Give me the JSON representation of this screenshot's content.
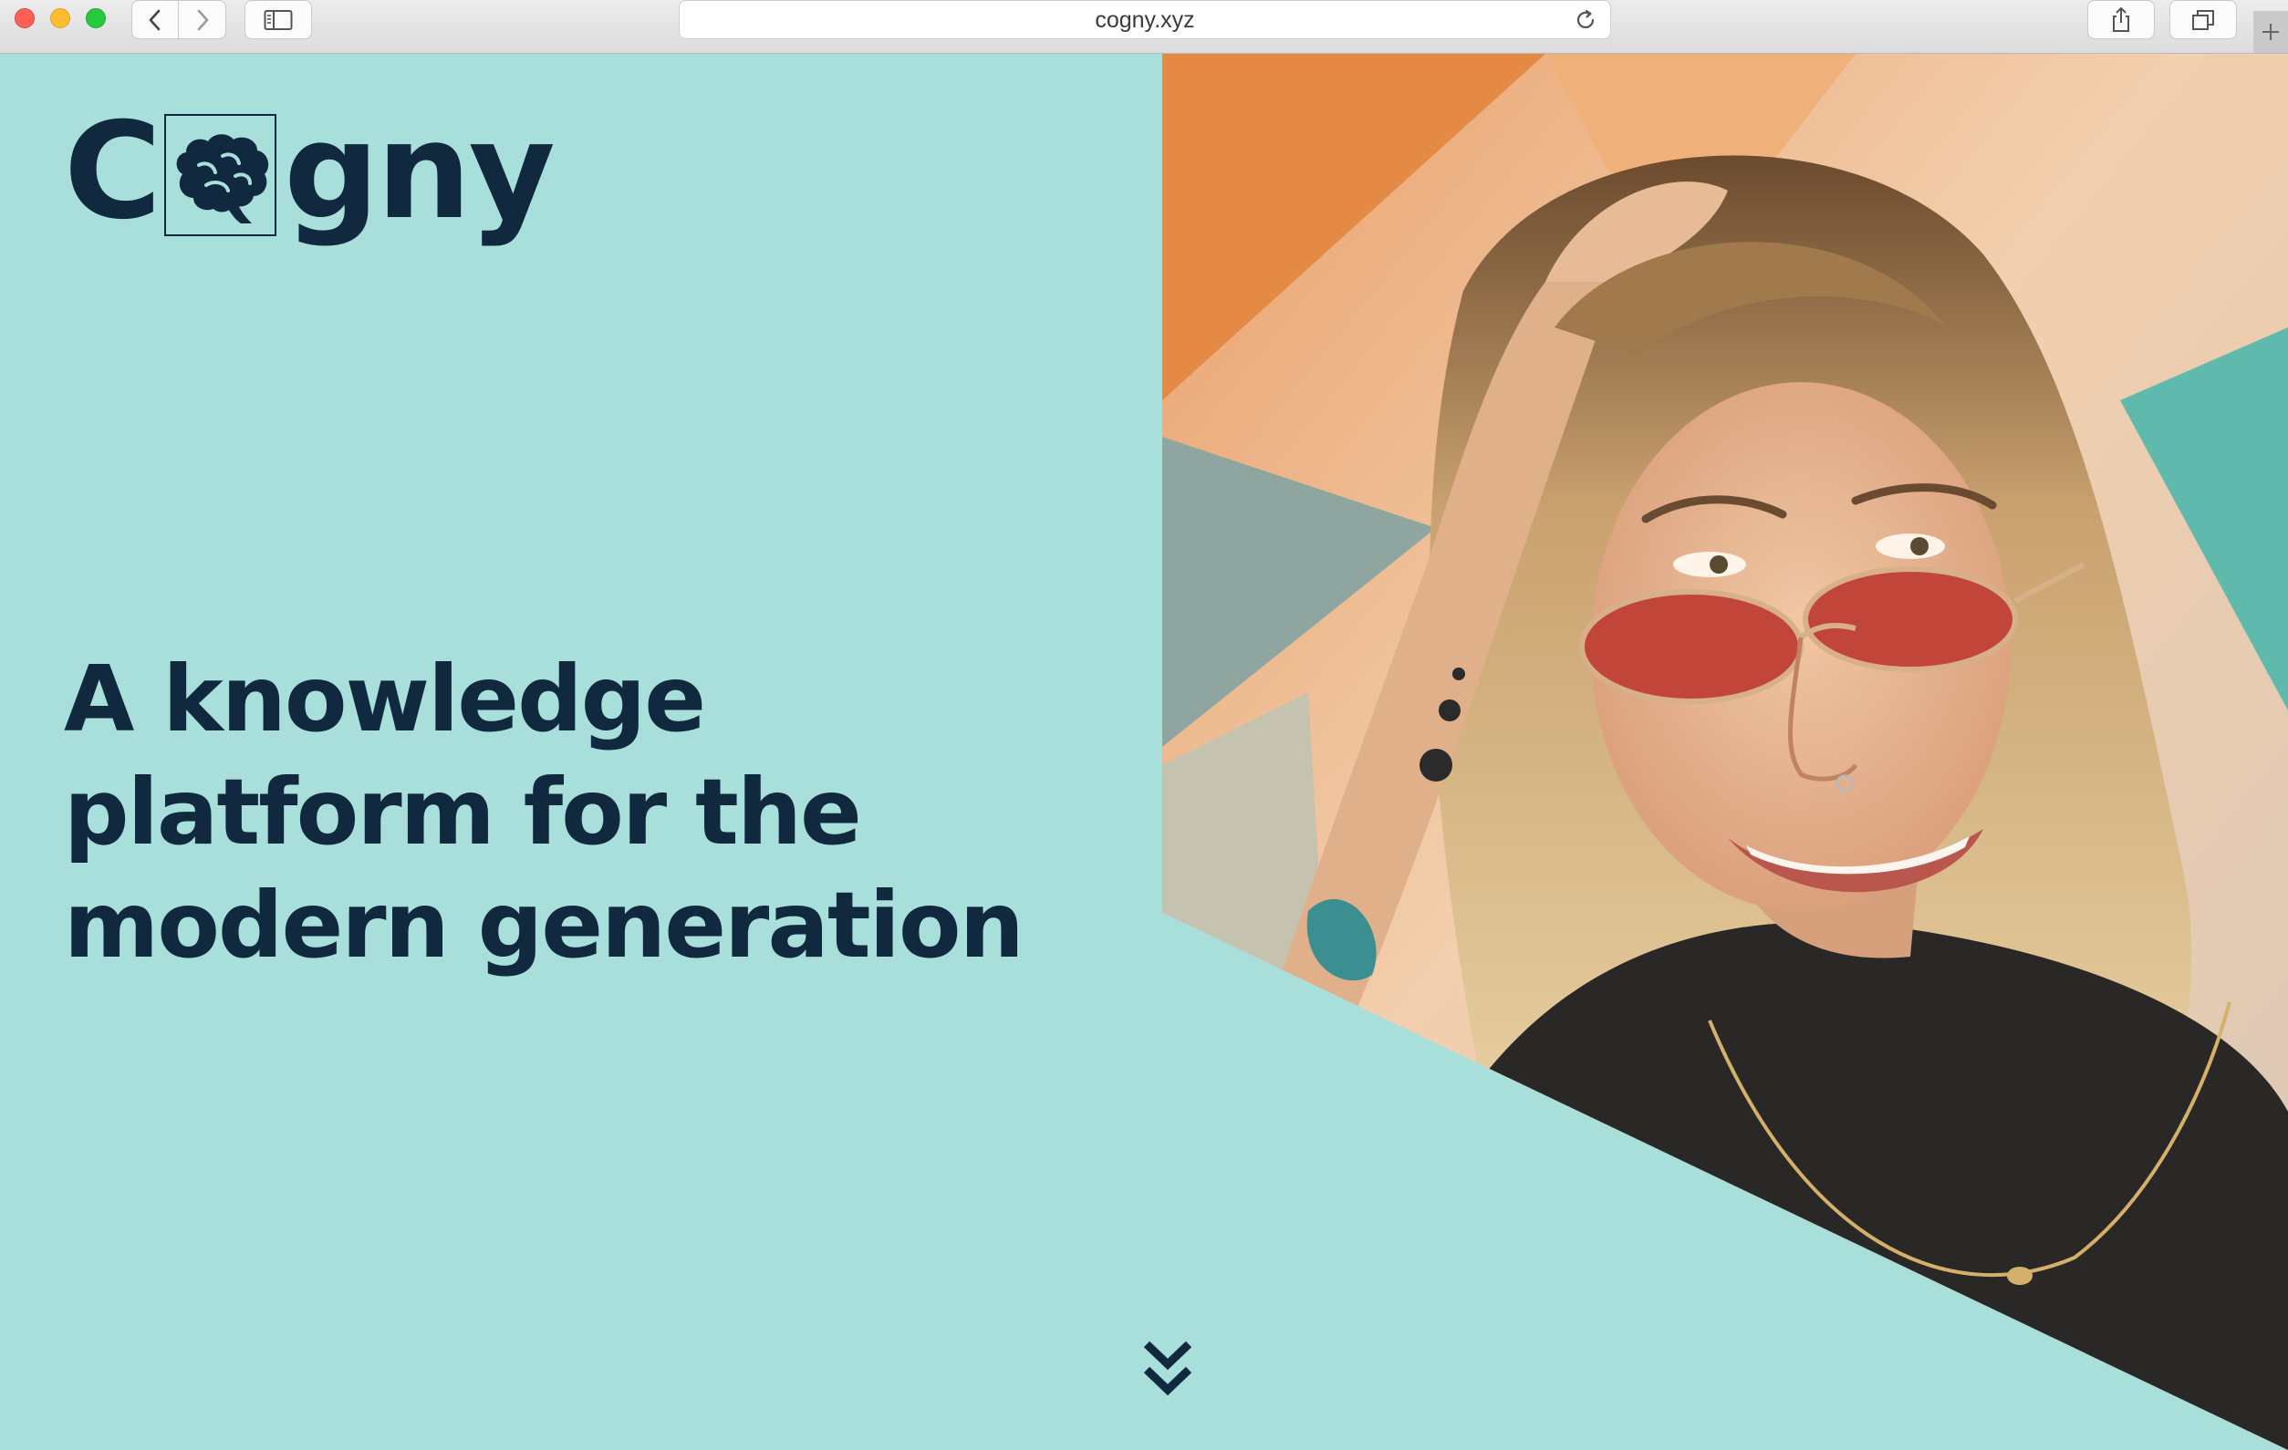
{
  "browser": {
    "url": "cogny.xyz",
    "buttons": {
      "back_icon": "chevron-left-icon",
      "forward_icon": "chevron-right-icon",
      "sidebar_icon": "sidebar-icon",
      "reload_icon": "reload-icon",
      "share_icon": "share-icon",
      "tabs_icon": "tabs-overview-icon",
      "new_tab_icon": "plus-icon"
    }
  },
  "brand": {
    "logo_prefix": "C",
    "logo_suffix": "gny",
    "logo_icon": "brain-icon",
    "color_text": "#10293f",
    "color_background": "#a8dfda"
  },
  "hero": {
    "headline": "A knowledge platform for the modern generation",
    "image_alt": "Smiling woman with red tinted sunglasses",
    "scroll_icon": "double-chevron-down-icon"
  }
}
